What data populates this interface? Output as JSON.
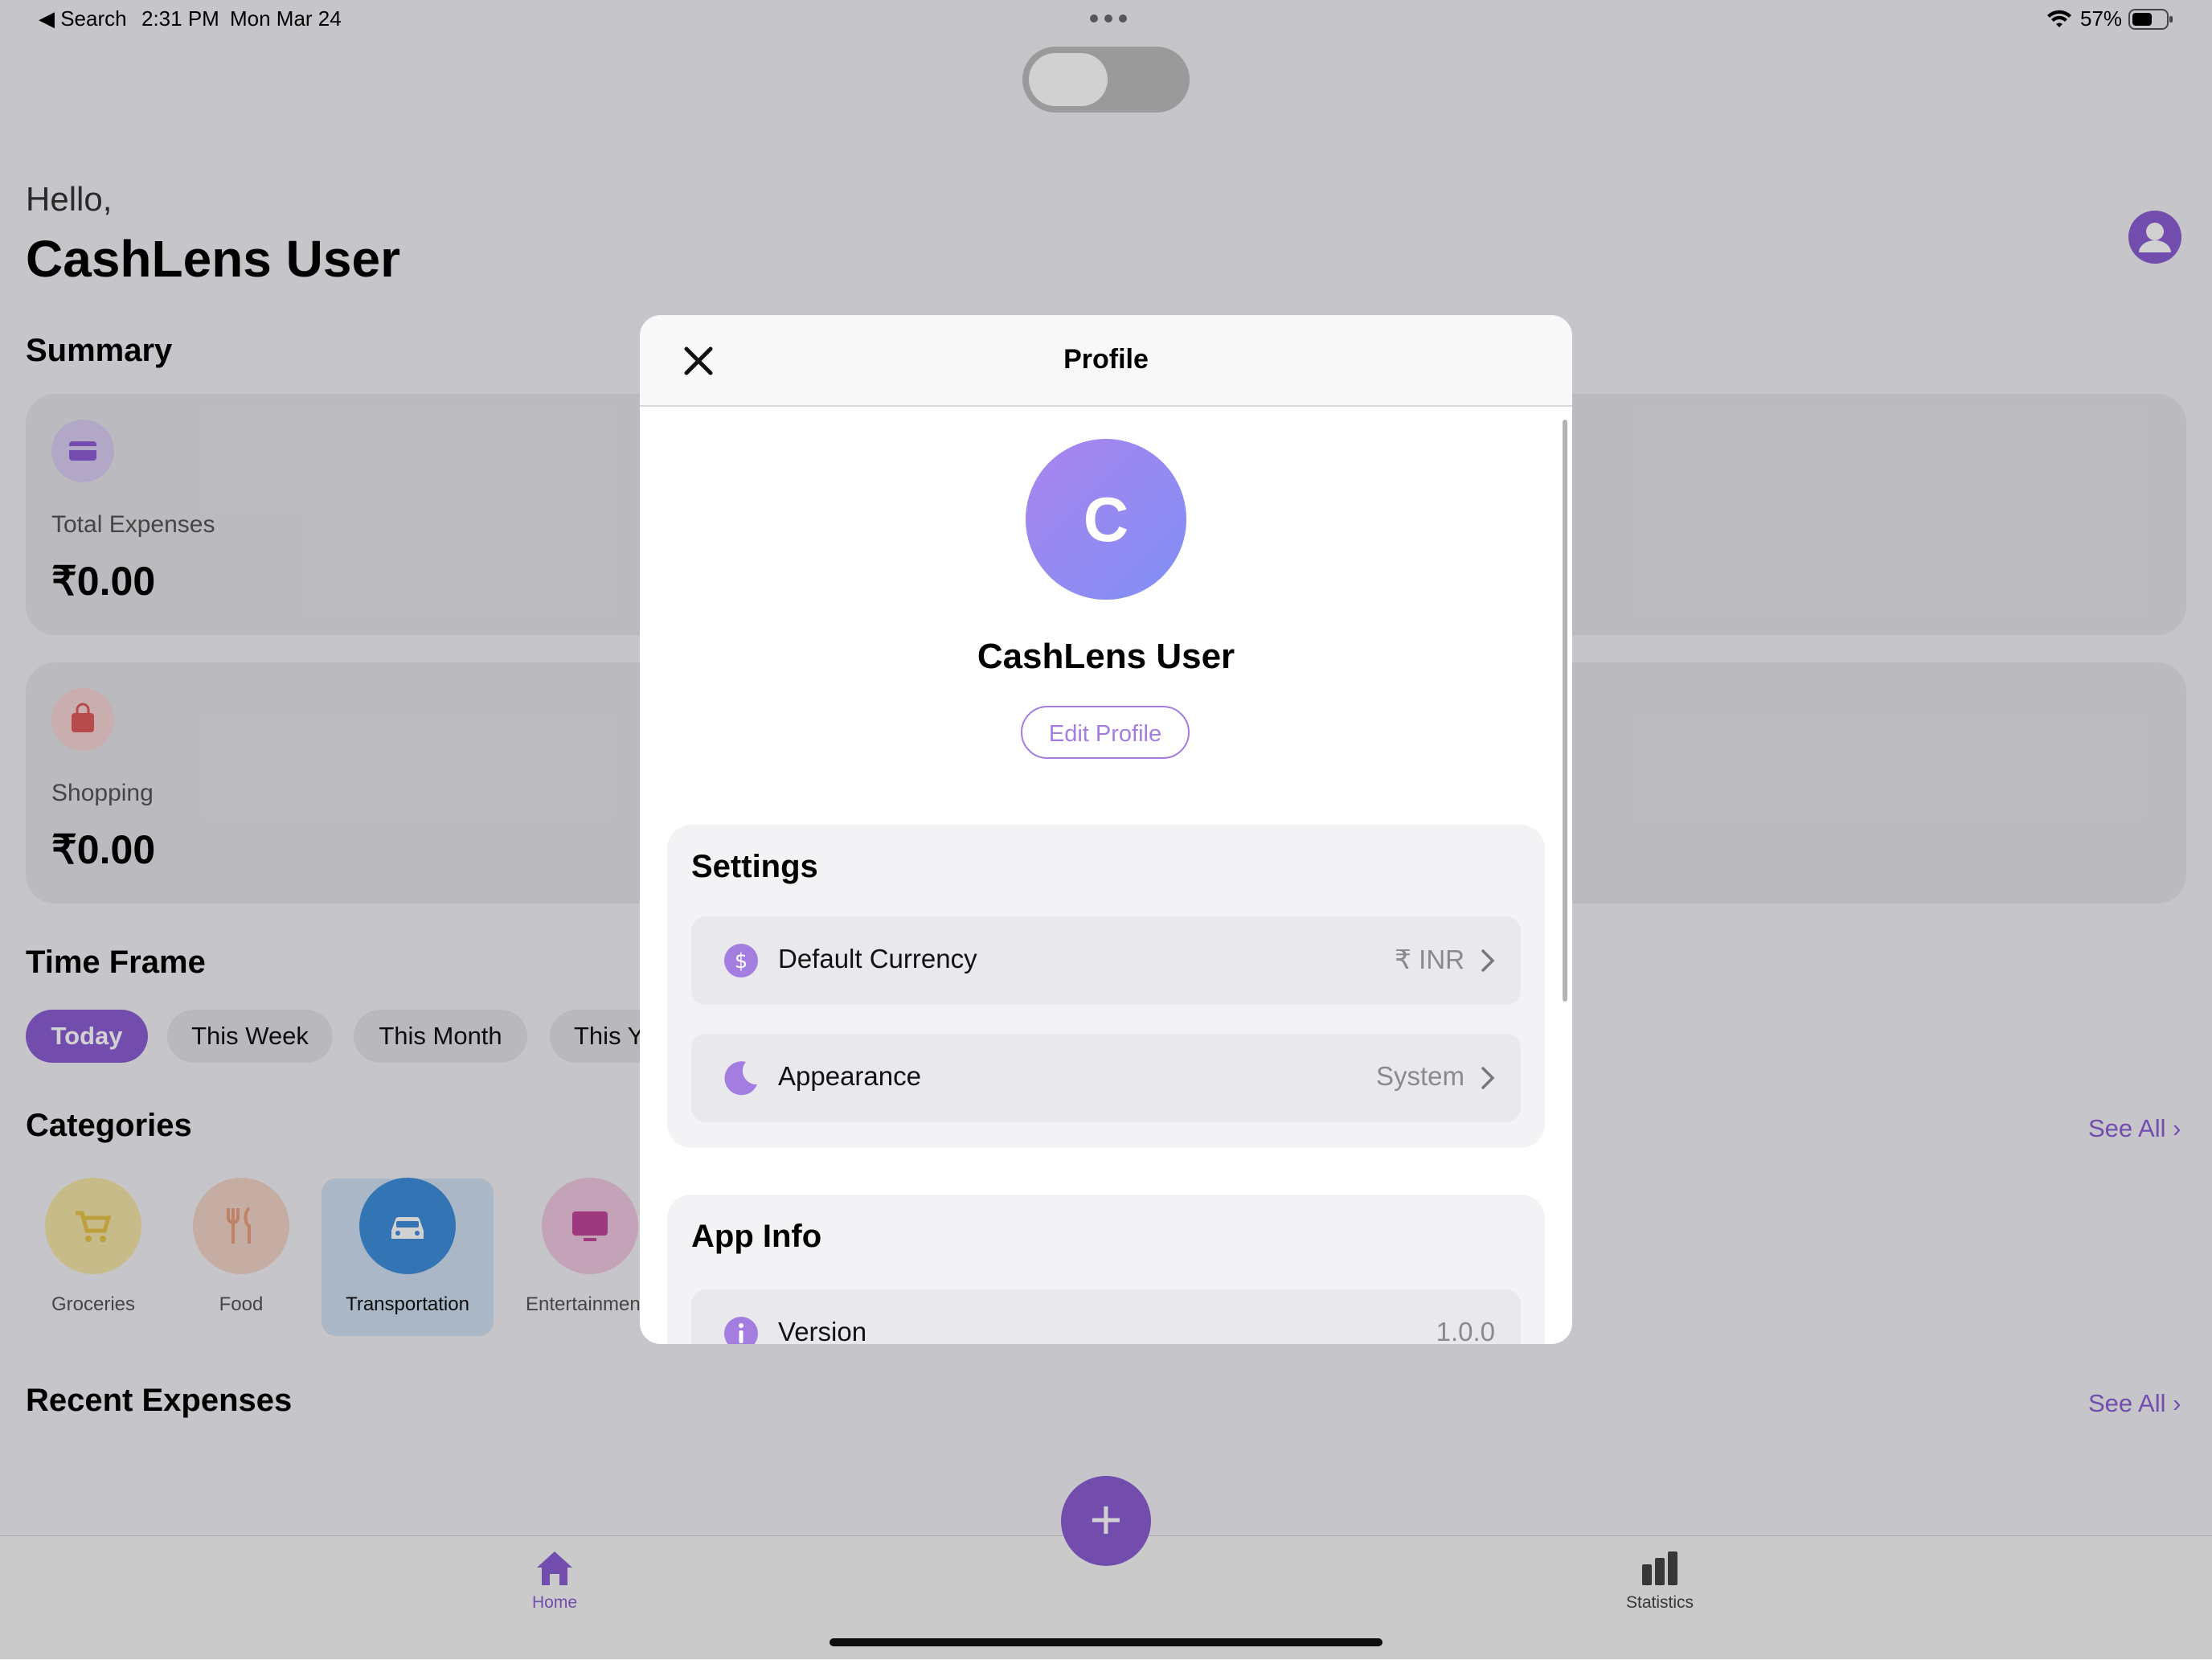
{
  "status_bar": {
    "back_label": "◀ Search",
    "time": "2:31 PM",
    "date": "Mon Mar 24",
    "battery": "57%"
  },
  "header": {
    "greeting": "Hello,",
    "user_name": "CashLens User"
  },
  "summary": {
    "title": "Summary",
    "cards": [
      {
        "label": "Total Expenses",
        "amount": "₹0.00",
        "icon": "credit-card-icon"
      },
      {
        "label": "Shopping",
        "amount": "₹0.00",
        "icon": "shopping-bag-icon"
      }
    ]
  },
  "time_frame": {
    "title": "Time Frame",
    "chips": [
      "Today",
      "This Week",
      "This Month",
      "This Y"
    ],
    "selected": "Today"
  },
  "categories": {
    "title": "Categories",
    "see_all": "See All",
    "items": [
      {
        "label": "Groceries",
        "icon": "cart-icon"
      },
      {
        "label": "Food",
        "icon": "fork-knife-icon"
      },
      {
        "label": "Transportation",
        "icon": "car-icon"
      },
      {
        "label": "Entertainmen",
        "icon": "tv-icon"
      }
    ],
    "selected": "Transportation"
  },
  "recent_expenses": {
    "title": "Recent Expenses",
    "see_all": "See All"
  },
  "tab_bar": {
    "home_label": "Home",
    "statistics_label": "Statistics",
    "add_label": "+"
  },
  "profile_modal": {
    "title": "Profile",
    "avatar_initial": "C",
    "name": "CashLens User",
    "edit_button": "Edit Profile",
    "settings": {
      "title": "Settings",
      "rows": [
        {
          "label": "Default Currency",
          "value": "₹ INR",
          "icon": "dollar-circle-icon"
        },
        {
          "label": "Appearance",
          "value": "System",
          "icon": "moon-icon"
        }
      ]
    },
    "app_info": {
      "title": "App Info",
      "rows": [
        {
          "label": "Version",
          "value": "1.0.0",
          "icon": "info-circle-icon"
        }
      ]
    }
  },
  "colors": {
    "accent": "#8d5fd3",
    "avatar_gradient_start": "#ab84ee",
    "avatar_gradient_end": "#7f8ff6",
    "transportation_blue": "#3f8fdc",
    "groceries_yellow": "#e6c44a",
    "food_orange": "#e8a07e",
    "shopping_red": "#e05b5b"
  }
}
